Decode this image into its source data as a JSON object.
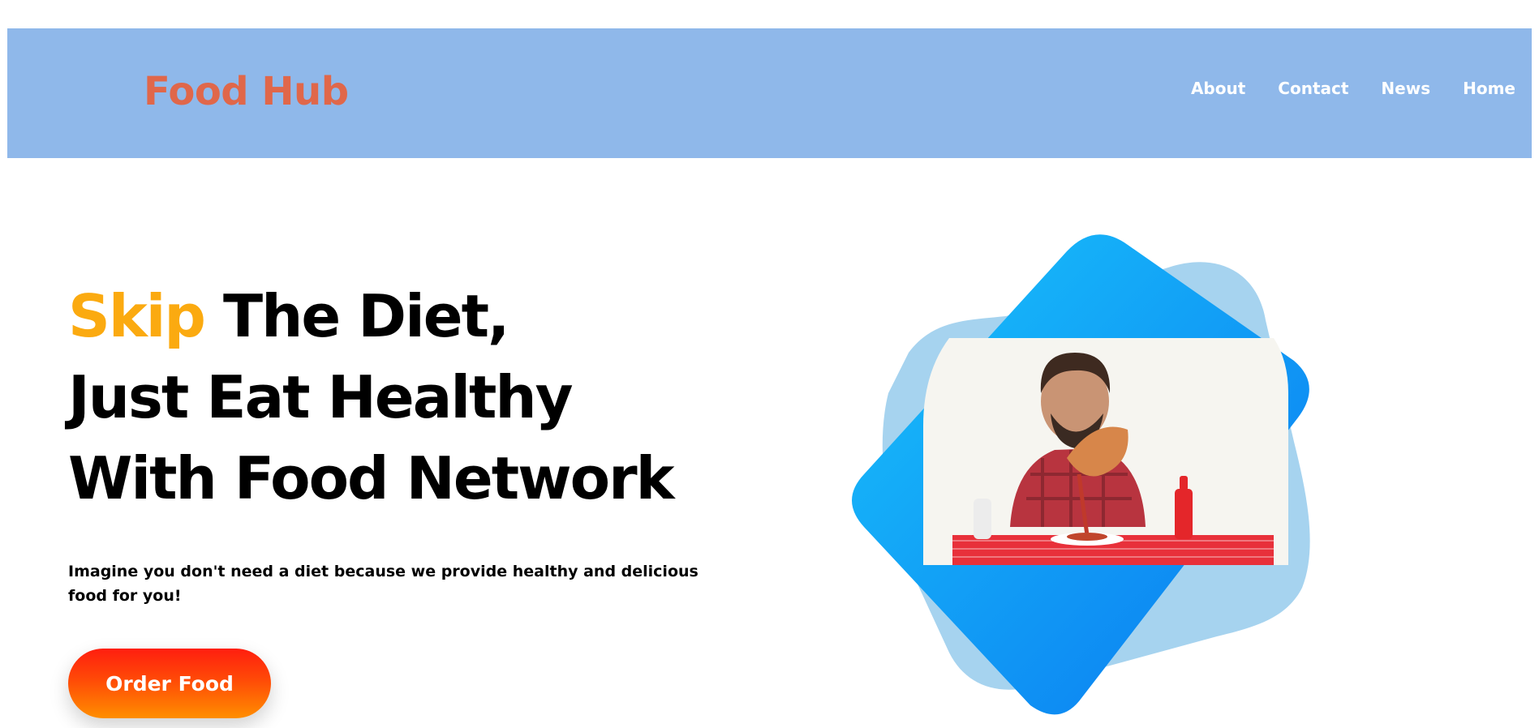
{
  "header": {
    "logo": "Food Hub",
    "nav": [
      "About",
      "Contact",
      "News",
      "Home"
    ]
  },
  "hero": {
    "title_accent": "Skip",
    "title_line1_rest": " The Diet,",
    "title_line2": "Just Eat Healthy",
    "title_line3": "With Food Network",
    "description": "Imagine you don't need a diet because we provide healthy and delicious food for you!",
    "cta_label": "Order Food"
  },
  "colors": {
    "header_bg": "#8fb8ea",
    "logo": "#e0674a",
    "accent": "#fbaa10",
    "button_top": "#ff1e0f",
    "button_bottom": "#ff8e00",
    "blob_light": "#a6d3ef",
    "blob_dark": "#0a88f4"
  }
}
